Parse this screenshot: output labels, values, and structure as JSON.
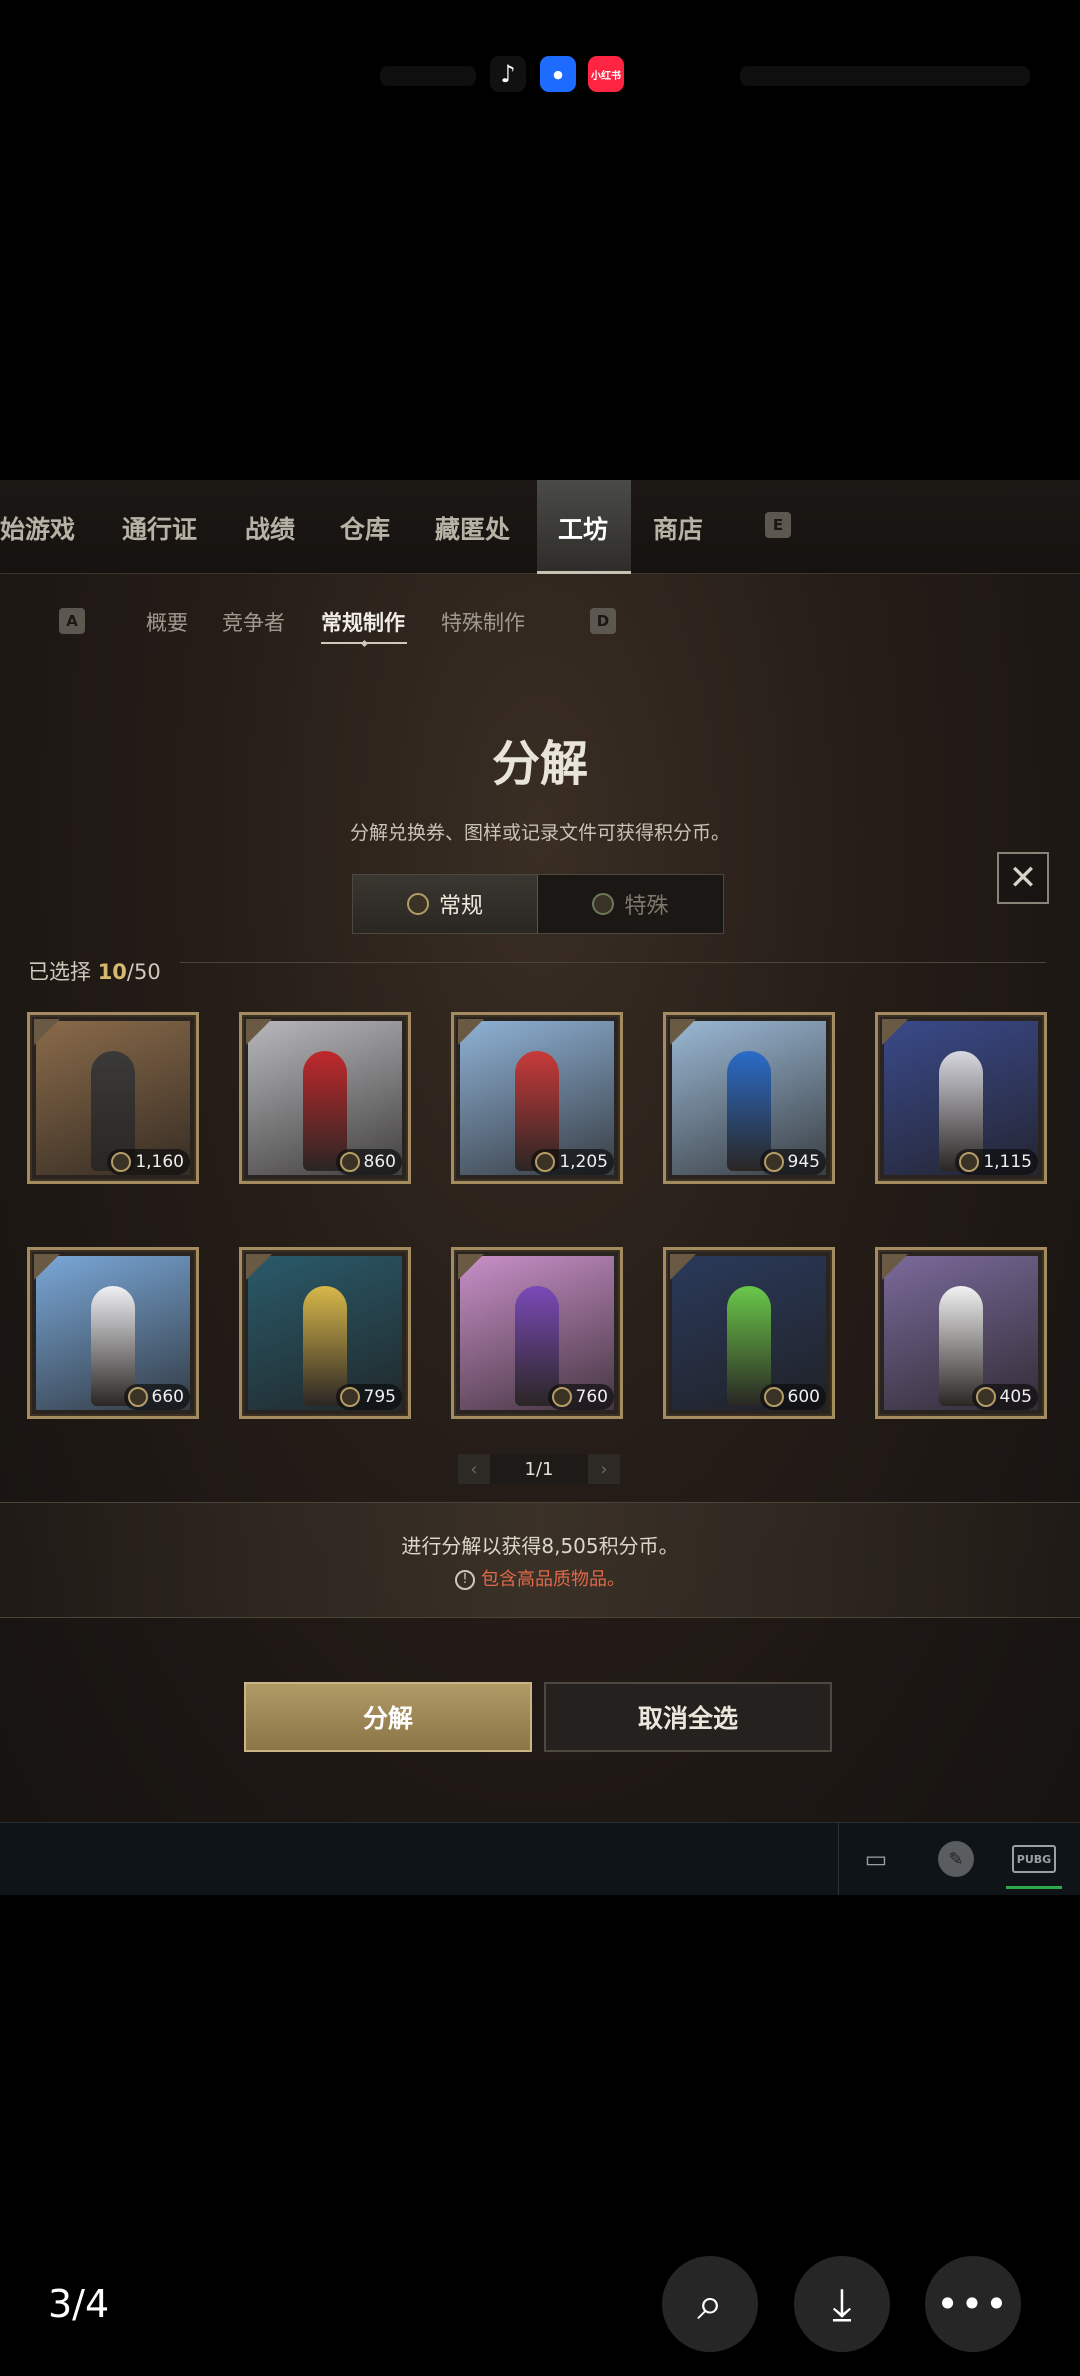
{
  "status_bar": {
    "icons": [
      {
        "name": "tiktok-icon",
        "glyph": "♪"
      },
      {
        "name": "message-icon",
        "glyph": "●"
      },
      {
        "name": "xiaohongshu-icon",
        "label": "小红书"
      }
    ]
  },
  "game": {
    "top_tabs": [
      {
        "label": "始游戏",
        "key": "start"
      },
      {
        "label": "通行证",
        "key": "pass"
      },
      {
        "label": "战绩",
        "key": "record"
      },
      {
        "label": "仓库",
        "key": "storage"
      },
      {
        "label": "藏匿处",
        "key": "stash"
      },
      {
        "label": "工坊",
        "key": "workshop",
        "active": true
      },
      {
        "label": "商店",
        "key": "shop"
      }
    ],
    "top_key_hint": "E",
    "sub_key_left": "A",
    "sub_key_right": "D",
    "sub_tabs": [
      {
        "label": "概要"
      },
      {
        "label": "竞争者"
      },
      {
        "label": "常规制作",
        "active": true
      },
      {
        "label": "特殊制作"
      }
    ],
    "title": "分解",
    "subtitle": "分解兑换券、图样或记录文件可获得积分币。",
    "close_glyph": "✕",
    "toggle": {
      "normal": "常规",
      "special": "特殊",
      "selected": "常规"
    },
    "selected_label": "已选择",
    "selected_count": "10",
    "selected_total": "/50",
    "items": [
      {
        "value": "1,160",
        "bg": "#8a6b4a",
        "accent": "#3a3a38"
      },
      {
        "value": "860",
        "bg": "#b8b8bc",
        "accent": "#c0282c"
      },
      {
        "value": "1,205",
        "bg": "#8fb2d6",
        "accent": "#c83a3a"
      },
      {
        "value": "945",
        "bg": "#9ab8d4",
        "accent": "#2a6cc8"
      },
      {
        "value": "1,115",
        "bg": "#3a4a8a",
        "accent": "#d8d8e0"
      },
      {
        "value": "660",
        "bg": "#7aa8d8",
        "accent": "#f0f0f4"
      },
      {
        "value": "795",
        "bg": "#2a5a6a",
        "accent": "#d8b84a"
      },
      {
        "value": "760",
        "bg": "#c890c8",
        "accent": "#7a4ab8"
      },
      {
        "value": "600",
        "bg": "#2a3a5a",
        "accent": "#6ac84a"
      },
      {
        "value": "405",
        "bg": "#7a6a9a",
        "accent": "#f2f2f2"
      }
    ],
    "pager": {
      "prev": "‹",
      "page": "1/1",
      "next": "›"
    },
    "gain_text": "进行分解以获得8,505积分币。",
    "warning_text": "包含高品质物品。",
    "btn_decompose": "分解",
    "btn_cancel": "取消全选",
    "bottom_pubg_label": "PUBG"
  },
  "viewer": {
    "counter": "3/4",
    "lens_glyph": "⌕",
    "download_glyph": "⤓",
    "more_glyph": "•••"
  }
}
